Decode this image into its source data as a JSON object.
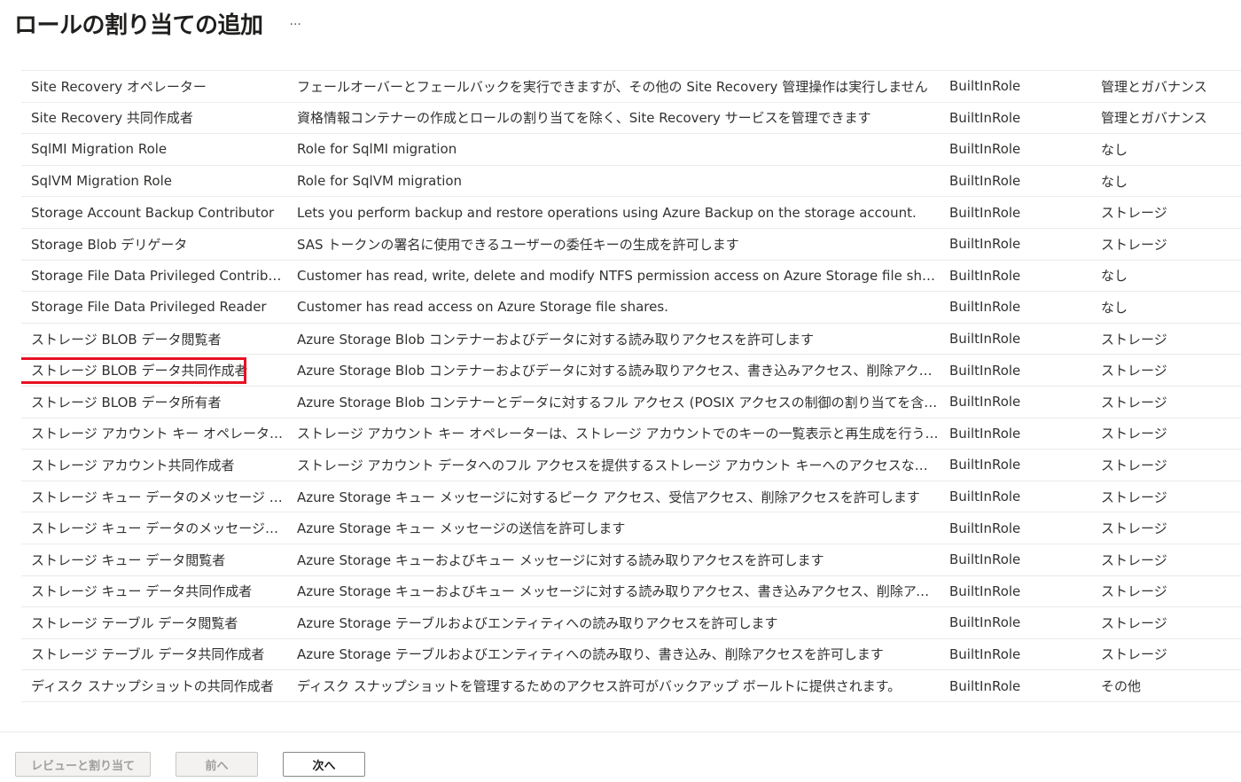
{
  "header": {
    "title": "ロールの割り当ての追加",
    "more_label": "···"
  },
  "roles": [
    {
      "name": "Site Recovery オペレーター",
      "description": "フェールオーバーとフェールバックを実行できますが、その他の Site Recovery 管理操作は実行しません",
      "type": "BuiltInRole",
      "category": "管理とガバナンス"
    },
    {
      "name": "Site Recovery 共同作成者",
      "description": "資格情報コンテナーの作成とロールの割り当てを除く、Site Recovery サービスを管理できます",
      "type": "BuiltInRole",
      "category": "管理とガバナンス"
    },
    {
      "name": "SqlMI Migration Role",
      "description": "Role for SqlMI migration",
      "type": "BuiltInRole",
      "category": "なし"
    },
    {
      "name": "SqlVM Migration Role",
      "description": "Role for SqlVM migration",
      "type": "BuiltInRole",
      "category": "なし"
    },
    {
      "name": "Storage Account Backup Contributor",
      "description": "Lets you perform backup and restore operations using Azure Backup on the storage account.",
      "type": "BuiltInRole",
      "category": "ストレージ"
    },
    {
      "name": "Storage Blob デリゲータ",
      "description": "SAS トークンの署名に使用できるユーザーの委任キーの生成を許可します",
      "type": "BuiltInRole",
      "category": "ストレージ"
    },
    {
      "name": "Storage File Data Privileged Contributor",
      "description": "Customer has read, write, delete and modify NTFS permission access on Azure Storage file shares.",
      "type": "BuiltInRole",
      "category": "なし"
    },
    {
      "name": "Storage File Data Privileged Reader",
      "description": "Customer has read access on Azure Storage file shares.",
      "type": "BuiltInRole",
      "category": "なし"
    },
    {
      "name": "ストレージ BLOB データ閲覧者",
      "description": "Azure Storage Blob コンテナーおよびデータに対する読み取りアクセスを許可します",
      "type": "BuiltInRole",
      "category": "ストレージ"
    },
    {
      "name": "ストレージ BLOB データ共同作成者",
      "description": "Azure Storage Blob コンテナーおよびデータに対する読み取りアクセス、書き込みアクセス、削除アクセスを許可します",
      "type": "BuiltInRole",
      "category": "ストレージ",
      "highlighted": true
    },
    {
      "name": "ストレージ BLOB データ所有者",
      "description": "Azure Storage Blob コンテナーとデータに対するフル アクセス (POSIX アクセスの制御の割り当てを含む) を許可します。",
      "type": "BuiltInRole",
      "category": "ストレージ"
    },
    {
      "name": "ストレージ アカウント キー オペレーターのサービス ロール",
      "description": "ストレージ アカウント キー オペレーターは、ストレージ アカウントでのキーの一覧表示と再生成を行うことができます",
      "type": "BuiltInRole",
      "category": "ストレージ"
    },
    {
      "name": "ストレージ アカウント共同作成者",
      "description": "ストレージ アカウント データへのフル アクセスを提供するストレージ アカウント キーへのアクセスなど、ストレージ アカウントを管理できます。",
      "type": "BuiltInRole",
      "category": "ストレージ"
    },
    {
      "name": "ストレージ キュー データのメッセージ プロセッサ",
      "description": "Azure Storage キュー メッセージに対するピーク アクセス、受信アクセス、削除アクセスを許可します",
      "type": "BuiltInRole",
      "category": "ストレージ"
    },
    {
      "name": "ストレージ キュー データのメッセージ送信者",
      "description": "Azure Storage キュー メッセージの送信を許可します",
      "type": "BuiltInRole",
      "category": "ストレージ"
    },
    {
      "name": "ストレージ キュー データ閲覧者",
      "description": "Azure Storage キューおよびキュー メッセージに対する読み取りアクセスを許可します",
      "type": "BuiltInRole",
      "category": "ストレージ"
    },
    {
      "name": "ストレージ キュー データ共同作成者",
      "description": "Azure Storage キューおよびキュー メッセージに対する読み取りアクセス、書き込みアクセス、削除アクセスを許可します",
      "type": "BuiltInRole",
      "category": "ストレージ"
    },
    {
      "name": "ストレージ テーブル データ閲覧者",
      "description": "Azure Storage テーブルおよびエンティティへの読み取りアクセスを許可します",
      "type": "BuiltInRole",
      "category": "ストレージ"
    },
    {
      "name": "ストレージ テーブル データ共同作成者",
      "description": "Azure Storage テーブルおよびエンティティへの読み取り、書き込み、削除アクセスを許可します",
      "type": "BuiltInRole",
      "category": "ストレージ"
    },
    {
      "name": "ディスク スナップショットの共同作成者",
      "description": "ディスク スナップショットを管理するためのアクセス許可がバックアップ ボールトに提供されます。",
      "type": "BuiltInRole",
      "category": "その他"
    }
  ],
  "footer": {
    "review_label": "レビューと割り当て",
    "prev_label": "前へ",
    "next_label": "次へ"
  },
  "colors": {
    "highlight_border": "#e81123",
    "row_separator": "#edebe9"
  }
}
